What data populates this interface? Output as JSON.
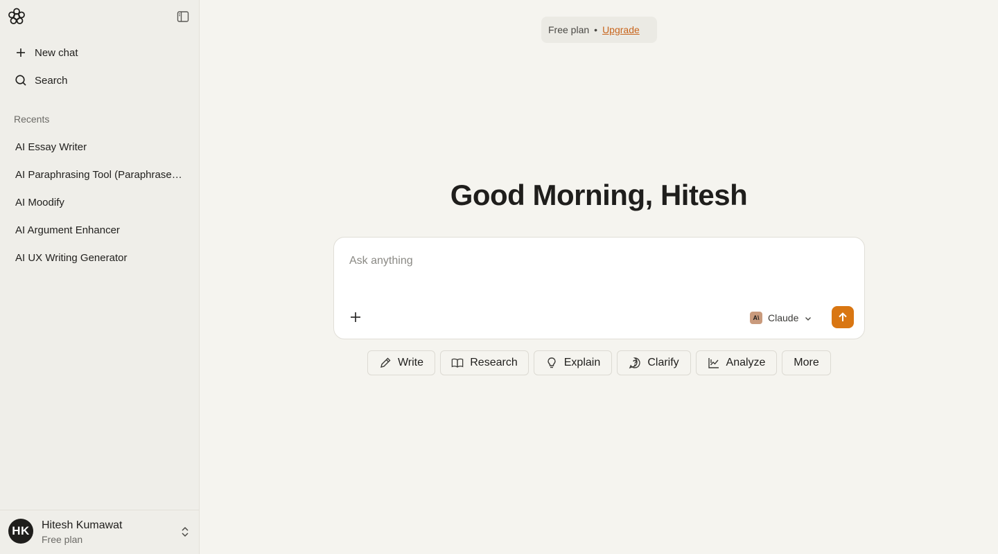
{
  "sidebar": {
    "new_chat_label": "New chat",
    "search_label": "Search",
    "recents_label": "Recents",
    "recents": [
      "AI Essay Writer",
      "AI Paraphrasing Tool (Paraphraser...",
      "AI Moodify",
      "AI Argument Enhancer",
      "AI UX Writing Generator"
    ],
    "profile": {
      "initials": "HK",
      "name": "Hitesh Kumawat",
      "plan": "Free plan"
    }
  },
  "header": {
    "plan_label": "Free plan",
    "separator": "•",
    "upgrade_label": "Upgrade"
  },
  "main": {
    "greeting": "Good Morning, Hitesh",
    "composer": {
      "placeholder": "Ask anything",
      "value": "",
      "model_label": "Claude",
      "model_icon_text": "A\\"
    },
    "chips": [
      {
        "label": "Write",
        "icon": "pencil-icon"
      },
      {
        "label": "Research",
        "icon": "book-icon"
      },
      {
        "label": "Explain",
        "icon": "lightbulb-icon"
      },
      {
        "label": "Clarify",
        "icon": "question-icon"
      },
      {
        "label": "Analyze",
        "icon": "chart-icon"
      },
      {
        "label": "More",
        "icon": ""
      }
    ]
  },
  "colors": {
    "accent": "#d97612",
    "upgrade_link": "#c8641b",
    "background": "#f5f4ef",
    "sidebar_bg": "#efeee9"
  }
}
